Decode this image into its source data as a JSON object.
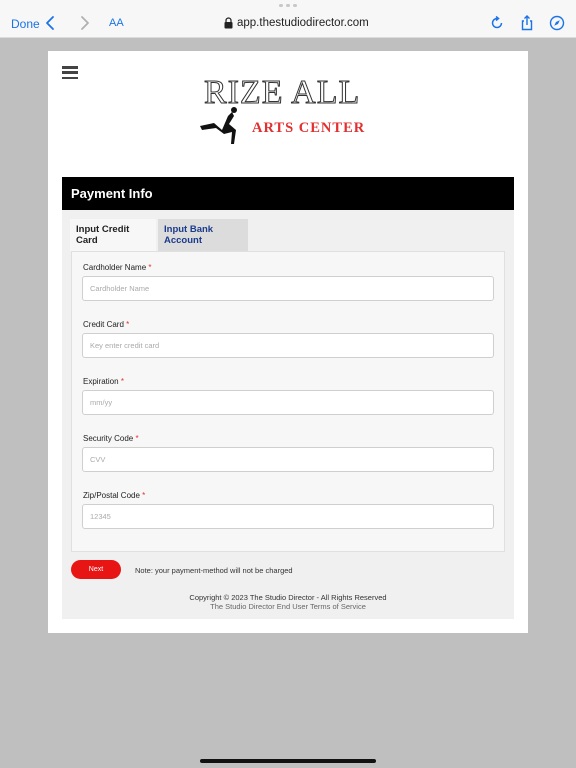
{
  "browser": {
    "done_label": "Done",
    "text_size_label": "AA",
    "url": "app.thestudiodirector.com"
  },
  "logo": {
    "line1": "RIZE ALL",
    "line2": "ARTS CENTER"
  },
  "section": {
    "title": "Payment Info"
  },
  "tabs": [
    {
      "label": "Input Credit Card",
      "active": true
    },
    {
      "label": "Input Bank Account",
      "active": false
    }
  ],
  "form": {
    "fields": [
      {
        "label": "Cardholder Name",
        "required": "*",
        "placeholder": "Cardholder Name"
      },
      {
        "label": "Credit Card",
        "required": "*",
        "placeholder": "Key enter credit card"
      },
      {
        "label": "Expiration",
        "required": "*",
        "placeholder": "mm/yy"
      },
      {
        "label": "Security Code",
        "required": "*",
        "placeholder": "CVV"
      },
      {
        "label": "Zip/Postal Code",
        "required": "*",
        "placeholder": "12345"
      }
    ],
    "next_label": "Next",
    "note": "Note: your payment-method will not be charged"
  },
  "footer": {
    "copyright": "Copyright © 2023 The Studio Director - All Rights Reserved",
    "terms": "The Studio Director End User Terms of Service"
  },
  "colors": {
    "accent": "#1a73e8",
    "brand_red": "#e81515",
    "header_bg": "#000000"
  }
}
